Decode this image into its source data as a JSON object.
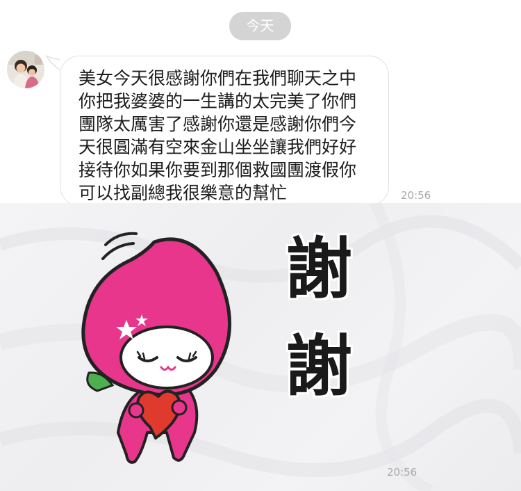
{
  "chat": {
    "date_divider": "今天",
    "messages": [
      {
        "sender_avatar": "avatar-photo",
        "lines": [
          "美女今天很感謝你們在我們聊天之中",
          "你把我婆婆的一生講的太完美了你們",
          "團隊太厲害了感謝你還是感謝你們今",
          "天很圓滿有空來金山坐坐讓我們好好",
          "接待你如果你要到那個救國團渡假你",
          "可以找副總我很樂意的幫忙"
        ],
        "time": "20:56"
      },
      {
        "type": "sticker",
        "sticker_text": [
          "謝",
          "謝"
        ],
        "time": "20:56"
      }
    ]
  },
  "colors": {
    "bubble_border": "#e0e0e0",
    "date_pill": "#d4d4d4",
    "sticker_pink": "#e7368b",
    "heart_red": "#e03a2e"
  }
}
